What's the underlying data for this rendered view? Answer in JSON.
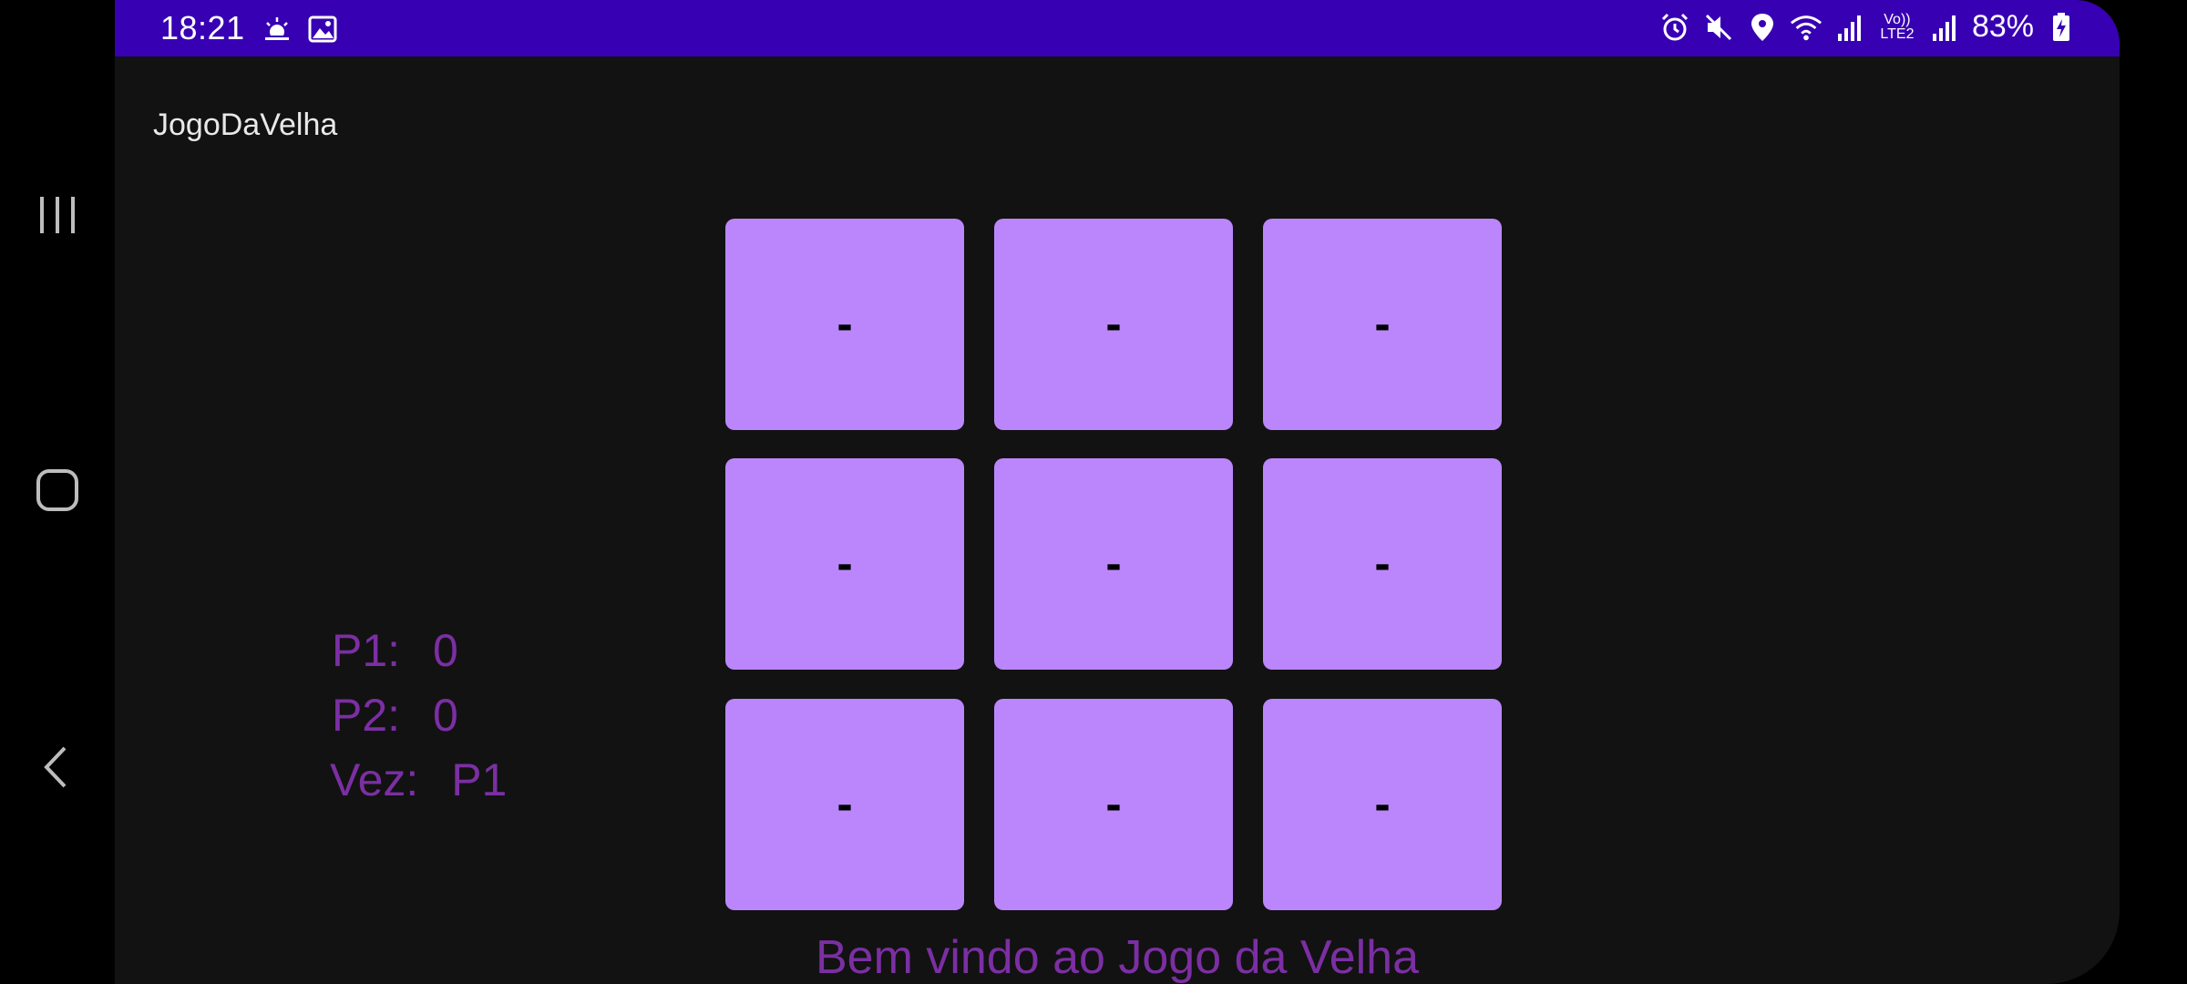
{
  "status_bar": {
    "time": "18:21",
    "left_icons": [
      "weather-icon",
      "image-icon"
    ],
    "right_icons": [
      "alarm-icon",
      "mute-icon",
      "location-icon",
      "wifi-icon",
      "signal-icon",
      "volte-icon",
      "signal-icon"
    ],
    "volte_label": "Vo)) LTE2",
    "battery": "83%"
  },
  "app": {
    "title": "JogoDaVelha"
  },
  "board": {
    "cells": [
      "-",
      "-",
      "-",
      "-",
      "-",
      "-",
      "-",
      "-",
      "-"
    ]
  },
  "score": {
    "p1_label": "P1:",
    "p1_value": "0",
    "p2_label": "P2:",
    "p2_value": "0",
    "turn_label": "Vez:",
    "turn_value": "P1"
  },
  "welcome_text": "Bem vindo ao Jogo da Velha",
  "colors": {
    "status_bar": "#3700b3",
    "background": "#121212",
    "cell": "#bb86fc",
    "accent_text": "#7b2fa3"
  }
}
